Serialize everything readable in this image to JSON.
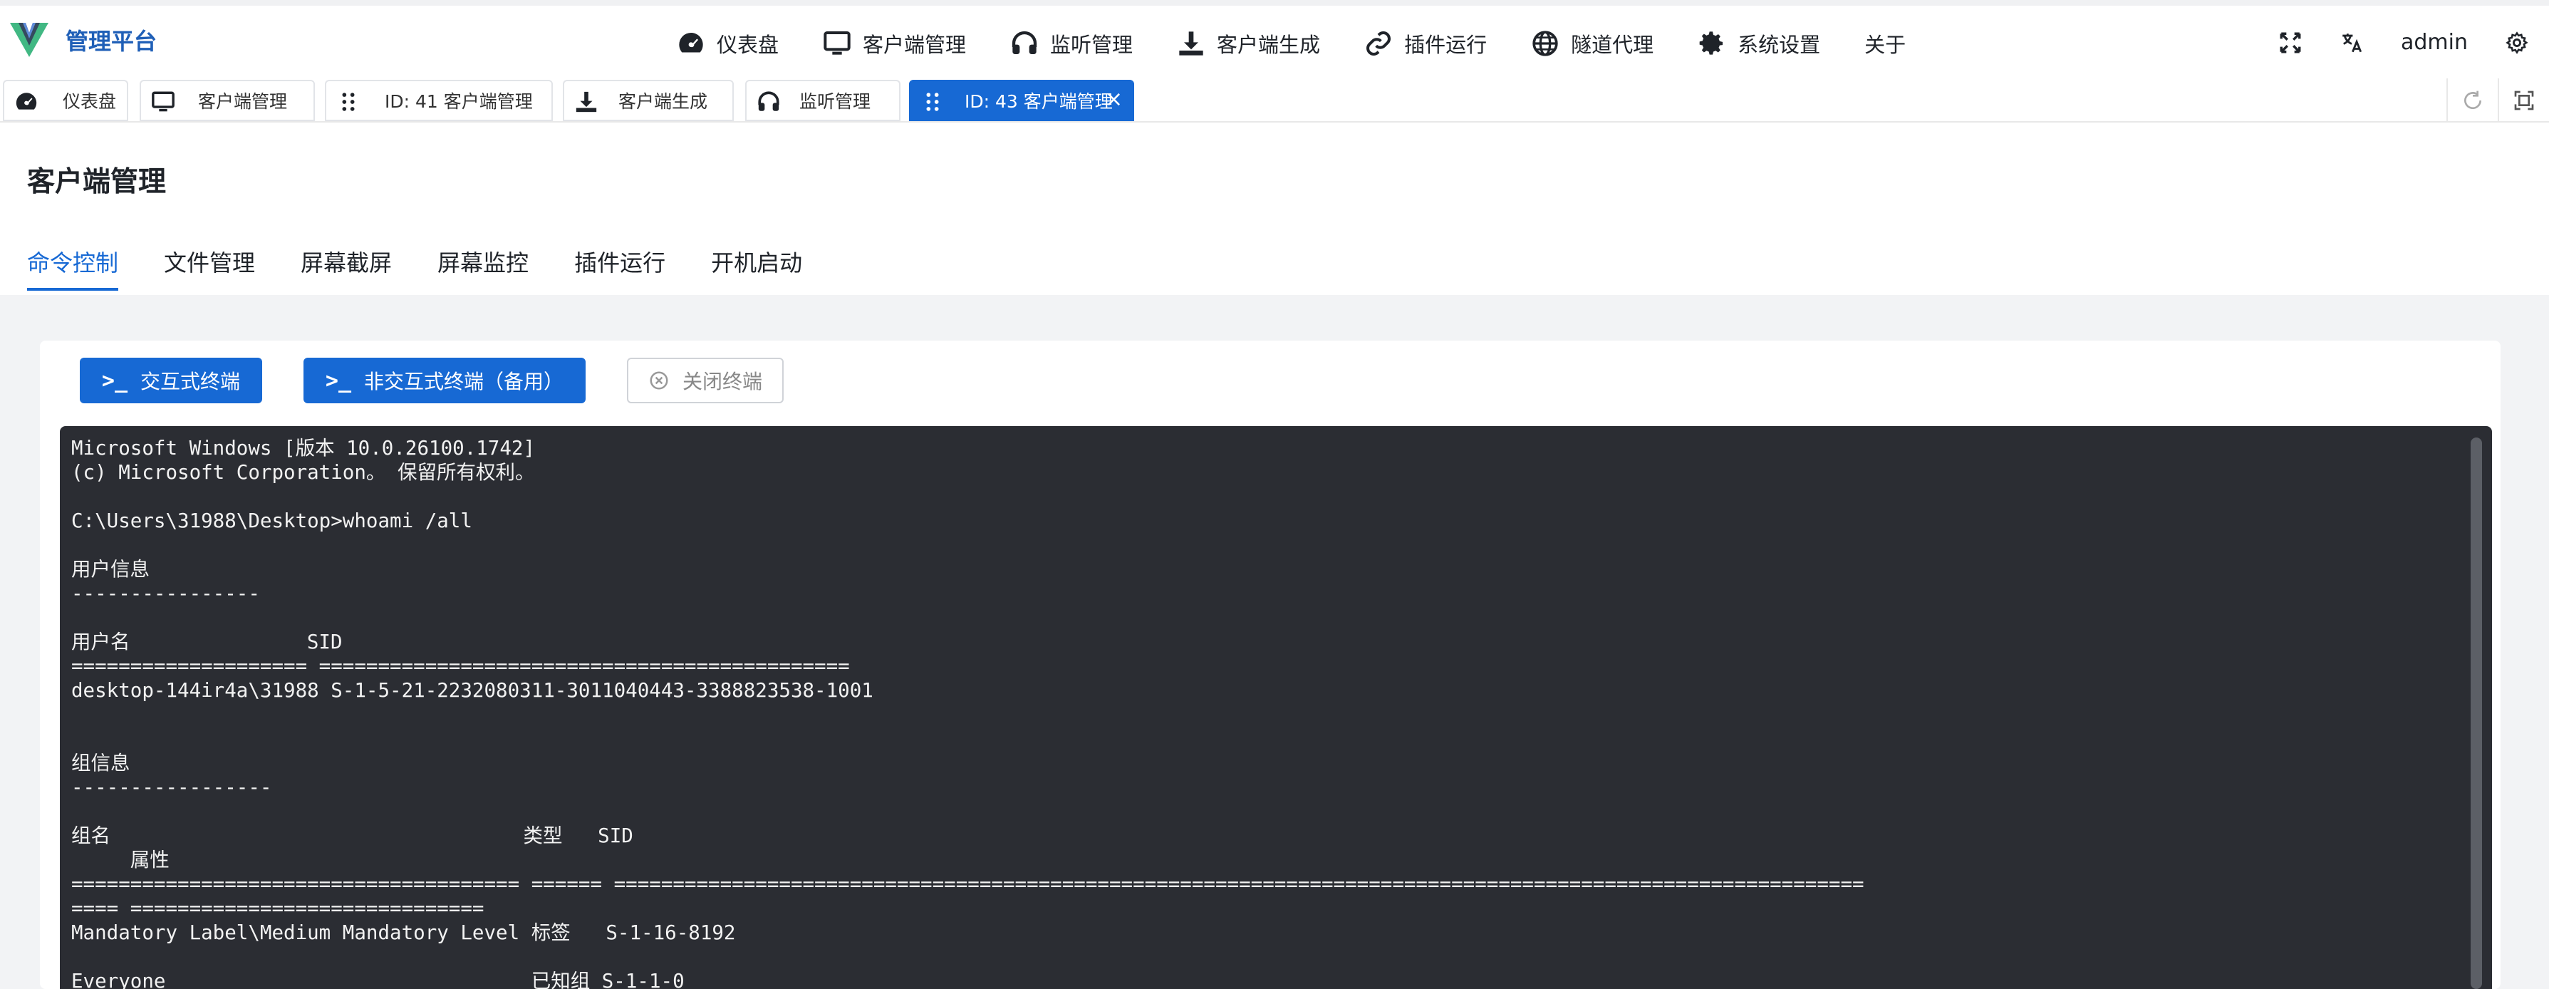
{
  "brand": {
    "name": "管理平台"
  },
  "nav": [
    {
      "label": "仪表盘",
      "icon": "dashboard-icon"
    },
    {
      "label": "客户端管理",
      "icon": "monitor-icon"
    },
    {
      "label": "监听管理",
      "icon": "headphones-icon"
    },
    {
      "label": "客户端生成",
      "icon": "download-icon"
    },
    {
      "label": "插件运行",
      "icon": "link-icon"
    },
    {
      "label": "隧道代理",
      "icon": "globe-icon"
    },
    {
      "label": "系统设置",
      "icon": "gear-icon"
    },
    {
      "label": "关于",
      "icon": ""
    }
  ],
  "header_right": {
    "user": "admin"
  },
  "tabs": [
    {
      "label": "仪表盘",
      "icon": "dashboard-icon"
    },
    {
      "label": "客户端管理",
      "icon": "monitor-icon"
    },
    {
      "label": "ID: 41 客户端管理",
      "icon": "grip-icon"
    },
    {
      "label": "客户端生成",
      "icon": "download-icon"
    },
    {
      "label": "监听管理",
      "icon": "headphones-icon"
    },
    {
      "label": "ID: 43 客户端管理",
      "icon": "grip-icon",
      "active": true,
      "close": "×"
    }
  ],
  "page": {
    "title": "客户端管理"
  },
  "subtabs": [
    {
      "label": "命令控制",
      "active": true
    },
    {
      "label": "文件管理"
    },
    {
      "label": "屏幕截屏"
    },
    {
      "label": "屏幕监控"
    },
    {
      "label": "插件运行"
    },
    {
      "label": "开机启动"
    }
  ],
  "toolbar": {
    "prompt_icon": ">_",
    "interactive_label": "交互式终端",
    "noninteractive_label": "非交互式终端（备用）",
    "close_label": "关闭终端"
  },
  "terminal": {
    "lines": [
      "Microsoft Windows [版本 10.0.26100.1742]",
      "(c) Microsoft Corporation。 保留所有权利。",
      "",
      "C:\\Users\\31988\\Desktop>whoami /all",
      "",
      "用户信息",
      "----------------",
      "",
      "用户名               SID",
      "==================== =============================================",
      "desktop-144ir4a\\31988 S-1-5-21-2232080311-3011040443-3388823538-1001",
      "",
      "",
      "组信息",
      "-----------------",
      "",
      "组名                                   类型   SID",
      "     属性",
      "====================================== ====== ==========================================================================================================",
      "==== ==============================",
      "Mandatory Label\\Medium Mandatory Level 标签   S-1-16-8192",
      "",
      "Everyone                               已知组 S-1-1-0"
    ]
  },
  "colors": {
    "primary": "#1769d4",
    "terminal_bg": "#2b2d33",
    "content_bg": "#f2f3f5"
  }
}
